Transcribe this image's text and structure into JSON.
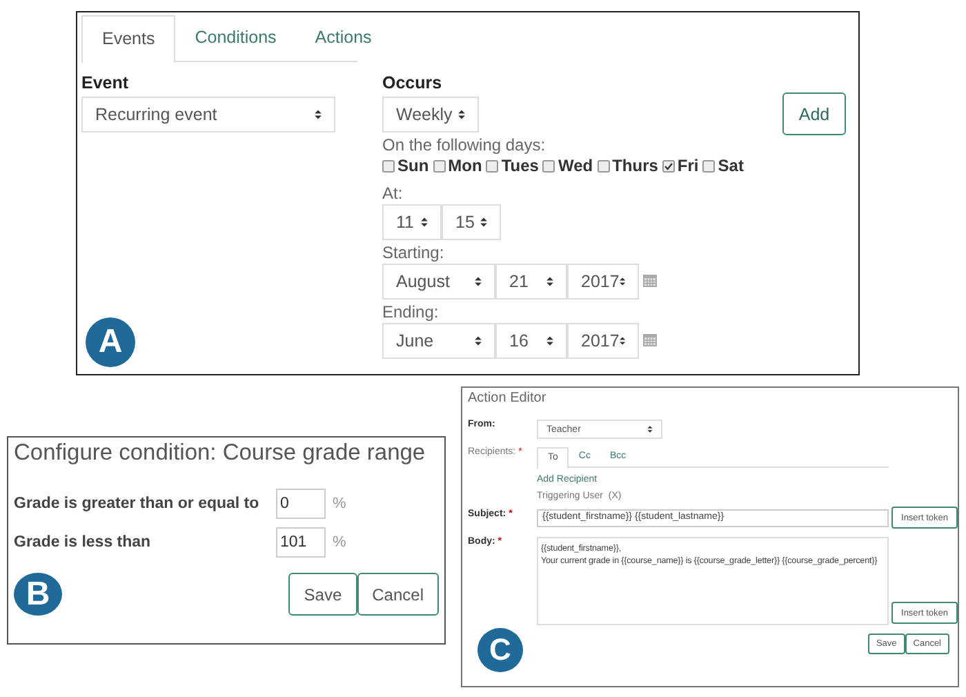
{
  "panel_a": {
    "badge": "A",
    "tabs": [
      {
        "label": "Events",
        "selected": true
      },
      {
        "label": "Conditions",
        "selected": false
      },
      {
        "label": "Actions",
        "selected": false
      }
    ],
    "event": {
      "label": "Event",
      "value": "Recurring event"
    },
    "occurs": {
      "label": "Occurs",
      "value": "Weekly"
    },
    "add_button": "Add",
    "days_label": "On the following days:",
    "days": [
      {
        "label": "Sun",
        "checked": false
      },
      {
        "label": "Mon",
        "checked": false
      },
      {
        "label": "Tues",
        "checked": false
      },
      {
        "label": "Wed",
        "checked": false
      },
      {
        "label": "Thurs",
        "checked": false
      },
      {
        "label": "Fri",
        "checked": true
      },
      {
        "label": "Sat",
        "checked": false
      }
    ],
    "at": {
      "label": "At:",
      "hour": "11",
      "minute": "15"
    },
    "starting": {
      "label": "Starting:",
      "month": "August",
      "day": "21",
      "year": "2017"
    },
    "ending": {
      "label": "Ending:",
      "month": "June",
      "day": "16",
      "year": "2017"
    }
  },
  "panel_b": {
    "badge": "B",
    "title": "Configure condition: Course grade range",
    "fields": [
      {
        "label": "Grade is greater than or equal to",
        "value": "0",
        "unit": "%"
      },
      {
        "label": "Grade is less than",
        "value": "101",
        "unit": "%"
      }
    ],
    "buttons": [
      "Save",
      "Cancel"
    ]
  },
  "panel_c": {
    "badge": "C",
    "title": "Action Editor",
    "from": {
      "label": "From:",
      "value": "Teacher"
    },
    "recipients": {
      "label": "Recipients:",
      "required_mark": "*",
      "tabs": [
        {
          "label": "To",
          "selected": true
        },
        {
          "label": "Cc",
          "selected": false
        },
        {
          "label": "Bcc",
          "selected": false
        }
      ],
      "add_link": "Add Recipient",
      "items": [
        "Triggering User  (X)"
      ]
    },
    "subject": {
      "label": "Subject:",
      "required_mark": "*",
      "value": "{{student_firstname}} {{student_lastname}}",
      "button": "Insert token"
    },
    "body": {
      "label": "Body:",
      "required_mark": "*",
      "lines": [
        "{{student_firstname}},",
        "Your current grade in {{course_name}} is {{course_grade_letter}} {{course_grade_percent}}"
      ],
      "button": "Insert token"
    },
    "buttons": [
      "Save",
      "Cancel"
    ]
  }
}
